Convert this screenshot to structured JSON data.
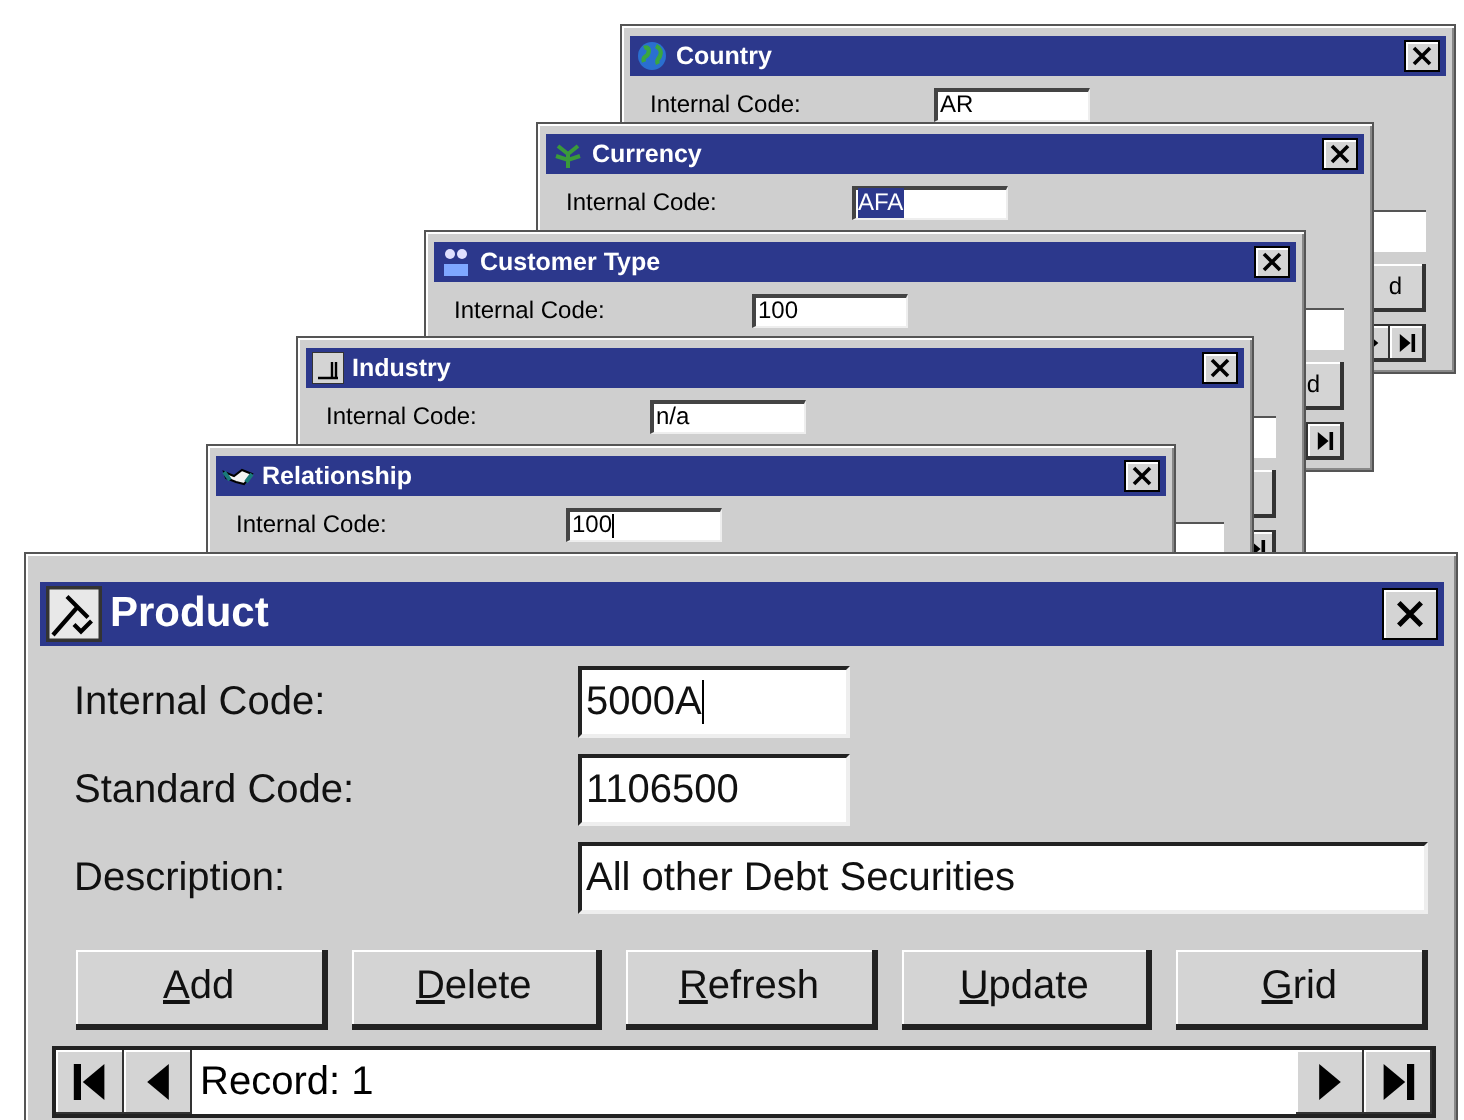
{
  "back_windows": [
    {
      "title": "Country",
      "label": "Internal Code:",
      "value": "AR",
      "selected": false,
      "focused": false,
      "button_fragment": "d"
    },
    {
      "title": "Currency",
      "label": "Internal Code:",
      "value": "AFA",
      "selected": true,
      "focused": false,
      "button_fragment": "d"
    },
    {
      "title": "Customer Type",
      "label": "Internal Code:",
      "value": "100",
      "selected": false,
      "focused": false
    },
    {
      "title": "Industry",
      "label": "Internal Code:",
      "value": "n/a",
      "selected": false,
      "focused": false
    },
    {
      "title": "Relationship",
      "label": "Internal Code:",
      "value": "100",
      "selected": false,
      "focused": true
    }
  ],
  "product": {
    "title": "Product",
    "fields": [
      {
        "label": "Internal Code:",
        "value": "5000A",
        "focused": true,
        "wide": false
      },
      {
        "label": "Standard Code:",
        "value": "1106500",
        "focused": false,
        "wide": false
      },
      {
        "label": "Description:",
        "value": "All other Debt Securities",
        "focused": false,
        "wide": true
      }
    ],
    "buttons": [
      "Add",
      "Delete",
      "Refresh",
      "Update",
      "Grid"
    ],
    "record": "Record: 1"
  }
}
